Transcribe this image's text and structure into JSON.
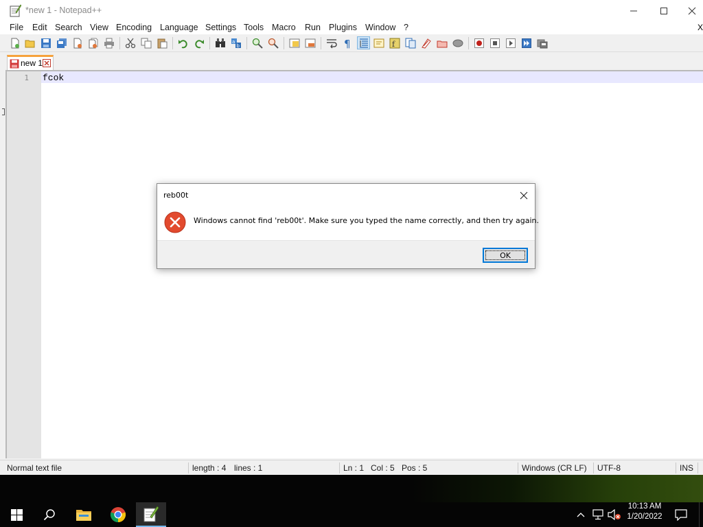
{
  "window": {
    "title": "*new 1 - Notepad++",
    "controls": {
      "minimize": "minimize-icon",
      "maximize": "maximize-icon",
      "close": "close-icon"
    }
  },
  "menu": {
    "items": [
      "File",
      "Edit",
      "Search",
      "View",
      "Encoding",
      "Language",
      "Settings",
      "Tools",
      "Macro",
      "Run",
      "Plugins",
      "Window",
      "?"
    ],
    "overflow": "X"
  },
  "toolbar": {
    "icons": [
      "new-file-icon",
      "open-file-icon",
      "save-icon",
      "save-all-icon",
      "close-file-icon",
      "close-all-icon",
      "print-icon",
      "cut-icon",
      "copy-icon",
      "paste-icon",
      "undo-icon",
      "redo-icon",
      "find-icon",
      "replace-icon",
      "zoom-in-icon",
      "zoom-out-icon",
      "sync-vertical-icon",
      "sync-horizontal-icon",
      "word-wrap-icon",
      "show-all-characters-icon",
      "indent-guide-icon",
      "language-icon",
      "function-list-icon",
      "document-map-icon",
      "folder-workspace-icon",
      "monitoring-icon",
      "speech-icon",
      "record-macro-icon",
      "stop-macro-icon",
      "play-macro-icon",
      "run-macro-multiple-icon",
      "save-macro-icon"
    ],
    "pressed": "indent-guide-icon"
  },
  "tab": {
    "label": "new 1",
    "state_icon": "unsaved-file-icon",
    "close_icon": "tab-close-icon"
  },
  "editor": {
    "line_number": "1",
    "text": "fcok"
  },
  "status": {
    "file_type": "Normal text file",
    "length": "length : 4",
    "lines": "lines : 1",
    "ln": "Ln : 1",
    "col": "Col : 5",
    "pos": "Pos : 5",
    "eol": "Windows (CR LF)",
    "encoding": "UTF-8",
    "mode": "INS"
  },
  "dialog": {
    "title": "reb00t",
    "message": "Windows cannot find 'reb00t'. Make sure you typed the name correctly, and then try again.",
    "ok_label": "OK",
    "icon": "error-icon"
  },
  "taskbar": {
    "apps": [
      "windows-start-icon",
      "search-icon",
      "file-explorer-icon",
      "chrome-icon",
      "notepad-plus-plus-icon"
    ],
    "active_app": "notepad-plus-plus-icon",
    "tray": [
      "chevron-up-icon",
      "network-icon",
      "volume-muted-icon",
      "notification-icon"
    ],
    "clock": {
      "time": "10:13 AM",
      "date": "1/20/2022"
    }
  },
  "colors": {
    "current_line": "#e8e8ff",
    "tab_accent": "#f6a23c",
    "dialog_focus": "#0078d7",
    "error_red": "#e24a2e",
    "taskbar": "#050505"
  }
}
